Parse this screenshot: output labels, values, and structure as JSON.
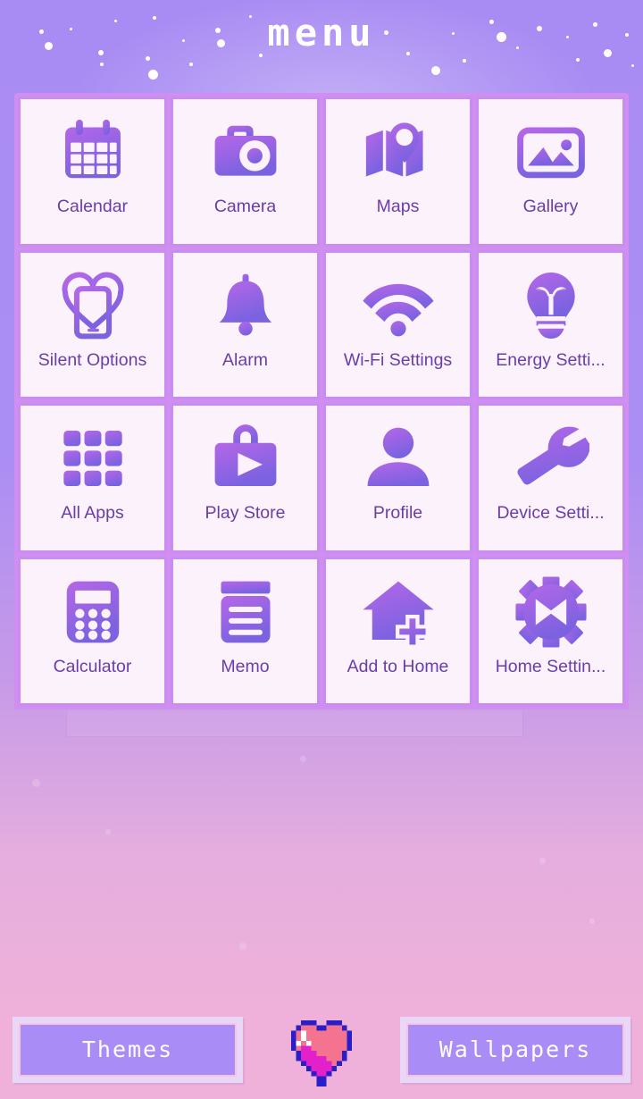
{
  "header": {
    "title": "menu"
  },
  "theme": {
    "background_pink": "#efb1d9",
    "header_purple": "#a98cf3",
    "tile_background": "#fbf2fb",
    "tile_border": "#c78df0",
    "icon_purple_light": "#b munge",
    "icon_gradient_start": "#b567e8",
    "icon_gradient_end": "#7a62e0",
    "label_text": "#6a3da9",
    "button_fill": "#a98cf5",
    "button_frame": "#e8d7f6",
    "button_inner_border": "#f6c3e0",
    "heart_outline": "#2a1ecb",
    "heart_fill": "#f4738f",
    "heart_shadow": "#e321c8",
    "heart_highlight": "#ffffff"
  },
  "apps": [
    {
      "label": "Calendar",
      "icon": "calendar-icon"
    },
    {
      "label": "Camera",
      "icon": "camera-icon"
    },
    {
      "label": "Maps",
      "icon": "maps-icon"
    },
    {
      "label": "Gallery",
      "icon": "gallery-icon"
    },
    {
      "label": "Silent Options",
      "icon": "silent-options-icon"
    },
    {
      "label": "Alarm",
      "icon": "alarm-bell-icon"
    },
    {
      "label": "Wi-Fi Settings",
      "icon": "wifi-icon"
    },
    {
      "label": "Energy Setti...",
      "icon": "lightbulb-icon"
    },
    {
      "label": "All Apps",
      "icon": "all-apps-grid-icon"
    },
    {
      "label": "Play Store",
      "icon": "play-store-bag-icon"
    },
    {
      "label": "Profile",
      "icon": "person-icon"
    },
    {
      "label": "Device Setti...",
      "icon": "wrench-icon"
    },
    {
      "label": "Calculator",
      "icon": "calculator-icon"
    },
    {
      "label": "Memo",
      "icon": "memo-notepad-icon"
    },
    {
      "label": "Add to Home",
      "icon": "house-plus-icon"
    },
    {
      "label": "Home Settin...",
      "icon": "gear-icon"
    }
  ],
  "bottom_bar": {
    "themes_label": "Themes",
    "wallpapers_label": "Wallpapers",
    "center_icon": "pixel-heart-icon"
  }
}
